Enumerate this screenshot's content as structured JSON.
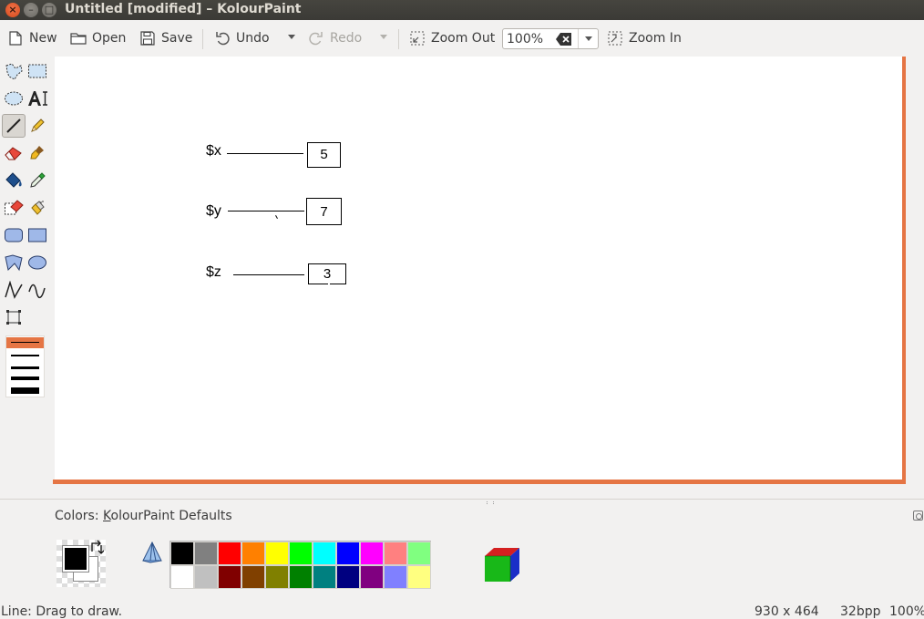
{
  "window": {
    "title": "Untitled [modified] – KolourPaint",
    "close_glyph": "×",
    "minimize_glyph": "–",
    "maximize_glyph": "□"
  },
  "toolbar": {
    "new_label": "New",
    "open_label": "Open",
    "save_label": "Save",
    "undo_label": "Undo",
    "redo_label": "Redo",
    "zoom_out_label": "Zoom Out",
    "zoom_value": "100%",
    "zoom_in_label": "Zoom In"
  },
  "tools": [
    {
      "name": "free-form-selection-icon"
    },
    {
      "name": "rectangular-selection-icon"
    },
    {
      "name": "elliptical-selection-icon"
    },
    {
      "name": "text-tool-icon"
    },
    {
      "name": "line-tool-icon",
      "active": true
    },
    {
      "name": "pen-tool-icon"
    },
    {
      "name": "eraser-tool-icon"
    },
    {
      "name": "brush-tool-icon"
    },
    {
      "name": "flood-fill-icon"
    },
    {
      "name": "color-picker-icon"
    },
    {
      "name": "color-eraser-icon"
    },
    {
      "name": "spraycan-icon"
    },
    {
      "name": "rounded-rectangle-icon"
    },
    {
      "name": "rectangle-icon"
    },
    {
      "name": "polygon-icon"
    },
    {
      "name": "ellipse-icon"
    },
    {
      "name": "connected-lines-icon"
    },
    {
      "name": "curve-icon"
    },
    {
      "name": "autocrop-icon"
    }
  ],
  "canvas": {
    "rows": [
      {
        "label": "$x",
        "value": "5"
      },
      {
        "label": "$y",
        "value": "7"
      },
      {
        "label": "$z",
        "value": "3"
      }
    ]
  },
  "colors": {
    "title_prefix": "Colors: ",
    "title_accel": "K",
    "title_rest": "olourPaint Defaults",
    "foreground": "#000000",
    "background": "#ffffff",
    "palette_row1": [
      "#000000",
      "#808080",
      "#ff0000",
      "#ff8000",
      "#ffff00",
      "#00ff00",
      "#00ffff",
      "#0000ff",
      "#ff00ff",
      "#ff8080",
      "#80ff80"
    ],
    "palette_row2": [
      "#ffffff",
      "#c0c0c0",
      "#800000",
      "#804000",
      "#808000",
      "#008000",
      "#008080",
      "#000080",
      "#800080",
      "#8080ff",
      "#ffff80"
    ]
  },
  "accent_color": "#e57544",
  "status": {
    "message": "Line: Drag to draw.",
    "image_size": "930 x 464",
    "color_depth": "32bpp",
    "zoom": "100%"
  }
}
